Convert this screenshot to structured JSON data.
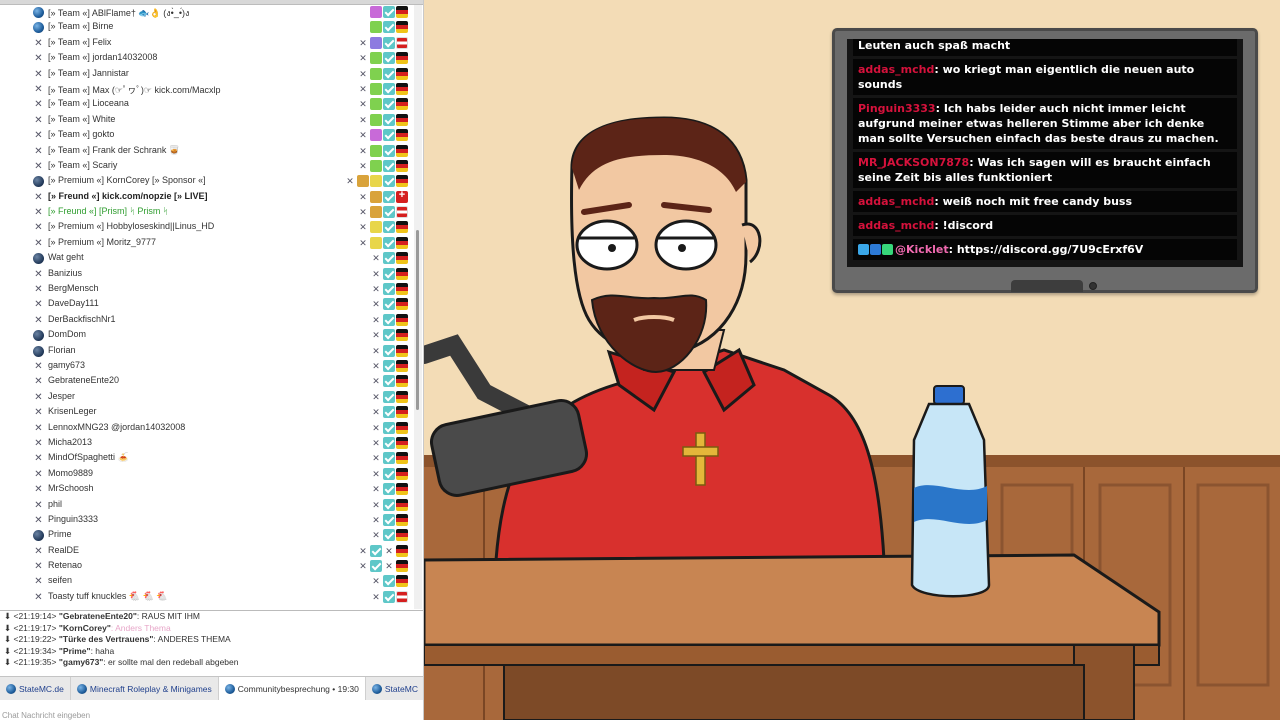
{
  "users": [
    {
      "name": "[» Team «] ABlFlame† 🐟👌 (ง•̀_•́)ง",
      "icon": "ball",
      "style": "",
      "badges": [
        "purple",
        "check",
        "de"
      ]
    },
    {
      "name": "[» Team «] Birne",
      "icon": "ball",
      "style": "",
      "badges": [
        "lime",
        "check",
        "de"
      ]
    },
    {
      "name": "[» Team «] Felix",
      "icon": "mute",
      "style": "",
      "badges": [
        "mute",
        "violet",
        "check",
        "at"
      ]
    },
    {
      "name": "[» Team «] jordan14032008",
      "icon": "mute",
      "style": "",
      "badges": [
        "mute",
        "lime",
        "check",
        "de"
      ]
    },
    {
      "name": "[» Team «] Jannistar",
      "icon": "mute",
      "style": "",
      "badges": [
        "mute",
        "lime",
        "check",
        "de"
      ]
    },
    {
      "name": "[» Team «] Max (☞ﾟヮﾟ)☞ kick.com/Macxlp",
      "icon": "mute",
      "style": "",
      "badges": [
        "mute",
        "lime",
        "check",
        "de"
      ]
    },
    {
      "name": "[» Team «] Lioceana",
      "icon": "mute",
      "style": "",
      "badges": [
        "mute",
        "lime",
        "check",
        "de"
      ]
    },
    {
      "name": "[» Team «] White",
      "icon": "mute",
      "style": "",
      "badges": [
        "mute",
        "lime",
        "check",
        "de"
      ]
    },
    {
      "name": "[» Team «] gokto",
      "icon": "mute",
      "style": "",
      "badges": [
        "mute",
        "purple",
        "check",
        "de"
      ]
    },
    {
      "name": "[» Team «] Frank der Schrank 🥃",
      "icon": "mute",
      "style": "",
      "badges": [
        "mute",
        "lime",
        "check",
        "de"
      ]
    },
    {
      "name": "[» Team «] Scariy",
      "icon": "mute",
      "style": "",
      "badges": [
        "mute",
        "lime",
        "check",
        "de"
      ]
    },
    {
      "name": "[» Premium «] KornCorey [» Sponsor «]",
      "icon": "dark",
      "style": "",
      "badges": [
        "mute",
        "gold",
        "yellow",
        "check",
        "de"
      ]
    },
    {
      "name": "[» Freund «] kick.com/nopzie [» LIVE]",
      "icon": "mute",
      "style": "bold",
      "badges": [
        "mute",
        "gold",
        "check",
        "ch"
      ]
    },
    {
      "name": "[» Freund «] [Prism] ᛋ Prism ᛋ",
      "icon": "mute",
      "style": "green",
      "badges": [
        "mute",
        "gold",
        "check",
        "at"
      ]
    },
    {
      "name": "[» Premium «] Hobbyloseskind||Linus_HD",
      "icon": "mute",
      "style": "",
      "badges": [
        "mute",
        "yellow",
        "check",
        "de"
      ]
    },
    {
      "name": "[» Premium «] Moritz_9777",
      "icon": "mute",
      "style": "",
      "badges": [
        "mute",
        "yellow",
        "check",
        "de"
      ]
    },
    {
      "name": "Wat geht",
      "icon": "dark",
      "style": "",
      "badges": [
        "mute",
        "check",
        "de"
      ]
    },
    {
      "name": "Banizius",
      "icon": "mute",
      "style": "",
      "badges": [
        "mute",
        "check",
        "de"
      ]
    },
    {
      "name": "BergMensch",
      "icon": "mute",
      "style": "",
      "badges": [
        "mute",
        "check",
        "de"
      ]
    },
    {
      "name": "DaveDay111",
      "icon": "mute",
      "style": "",
      "badges": [
        "mute",
        "check",
        "de"
      ]
    },
    {
      "name": "DerBackfischNr1",
      "icon": "mute",
      "style": "",
      "badges": [
        "mute",
        "check",
        "de"
      ]
    },
    {
      "name": "DomDom",
      "icon": "dark",
      "style": "",
      "badges": [
        "mute",
        "check",
        "de"
      ]
    },
    {
      "name": "Florian",
      "icon": "dark",
      "style": "",
      "badges": [
        "mute",
        "check",
        "de"
      ]
    },
    {
      "name": "gamy673",
      "icon": "mute",
      "style": "",
      "badges": [
        "mute",
        "check",
        "de"
      ]
    },
    {
      "name": "GebrateneEnte20",
      "icon": "mute",
      "style": "",
      "badges": [
        "mute",
        "check",
        "de"
      ]
    },
    {
      "name": "Jesper",
      "icon": "mute",
      "style": "",
      "badges": [
        "mute",
        "check",
        "de"
      ]
    },
    {
      "name": "KrisenLeger",
      "icon": "mute",
      "style": "",
      "badges": [
        "mute",
        "check",
        "de"
      ]
    },
    {
      "name": "LennoxMNG23 @jordan14032008",
      "icon": "mute",
      "style": "",
      "badges": [
        "mute",
        "check",
        "de"
      ]
    },
    {
      "name": "Micha2013",
      "icon": "mute",
      "style": "",
      "badges": [
        "mute",
        "check",
        "de"
      ]
    },
    {
      "name": "MindOfSpaghetti 🍝",
      "icon": "mute",
      "style": "",
      "badges": [
        "mute",
        "check",
        "de"
      ]
    },
    {
      "name": "Momo9889",
      "icon": "mute",
      "style": "",
      "badges": [
        "mute",
        "check",
        "de"
      ]
    },
    {
      "name": "MrSchoosh",
      "icon": "mute",
      "style": "",
      "badges": [
        "mute",
        "check",
        "de"
      ]
    },
    {
      "name": "phil",
      "icon": "mute",
      "style": "",
      "badges": [
        "mute",
        "check",
        "de"
      ]
    },
    {
      "name": "Pinguin3333",
      "icon": "mute",
      "style": "",
      "badges": [
        "mute",
        "check",
        "de"
      ]
    },
    {
      "name": "Prime",
      "icon": "dark",
      "style": "",
      "badges": [
        "mute",
        "check",
        "de"
      ]
    },
    {
      "name": "RealDE",
      "icon": "mute",
      "style": "",
      "badges": [
        "mute",
        "check",
        "mute",
        "de"
      ]
    },
    {
      "name": "Retenao",
      "icon": "mute",
      "style": "",
      "badges": [
        "mute",
        "check",
        "mute",
        "de"
      ]
    },
    {
      "name": "seifen",
      "icon": "mute",
      "style": "",
      "badges": [
        "mute",
        "check",
        "de"
      ]
    },
    {
      "name": "Toasty tuff knuckles 🐔 🐔 🐔",
      "icon": "mute",
      "style": "",
      "badges": [
        "mute",
        "check",
        "at"
      ]
    }
  ],
  "chat_log": [
    {
      "time": "<21:19:14>",
      "user": "\"GebrateneEnte20\"",
      "text": ": RAUS MIT IHM",
      "faint": false
    },
    {
      "time": "<21:19:17>",
      "user": "\"KornCorey\"",
      "text": ": Anders Thema",
      "faint": true
    },
    {
      "time": "<21:19:22>",
      "user": "\"Türke des Vertrauens\"",
      "text": ": ANDERES THEMA",
      "faint": false
    },
    {
      "time": "<21:19:34>",
      "user": "\"Prime\"",
      "text": ": haha",
      "faint": false
    },
    {
      "time": "<21:19:35>",
      "user": "\"gamy673\"",
      "text": ": er sollte mal den redeball abgeben",
      "faint": false
    }
  ],
  "tabs": [
    {
      "label": "StateMC.de",
      "active": false
    },
    {
      "label": "Minecraft Roleplay & Minigames",
      "active": false
    },
    {
      "label": "Communitybesprechung • 19:30",
      "active": true
    },
    {
      "label": "StateMC",
      "active": false
    }
  ],
  "chat_input_placeholder": "Chat Nachricht eingeben",
  "tv_chat": [
    {
      "user": "",
      "text": "Leuten auch spaß macht",
      "user_color": "red",
      "first": true
    },
    {
      "user": "addas_mchd",
      "text": ": wo kriegt man eigentlich die neuen auto sounds",
      "user_color": "red"
    },
    {
      "user": "Pinguin3333",
      "text": ": Ich habs leider auch nicht immer leicht aufgrund meiner etwas helleren Stimme aber ich denke man sollte Versuchen einfach das beste draus zu machen.",
      "user_color": "red"
    },
    {
      "user": "MR_JACKSON7878",
      "text": ": Was ich sagen will es braucht einfach seine Zeit bis alles funktioniert",
      "user_color": "red"
    },
    {
      "user": "addas_mchd",
      "text": ": weiß noch mit free candy buss",
      "user_color": "red"
    },
    {
      "user": "addas_mchd",
      "text": ": !discord",
      "user_color": "red"
    },
    {
      "user": "@Kicklet",
      "text": ": https://discord.gg/7U9cErxf6V",
      "user_color": "pink",
      "emotes": true
    }
  ],
  "colors": {
    "badge_check": "#5ec7c8",
    "chat_user_red": "#d6123c",
    "kicklet_pink": "#f06ab0",
    "wall": "#f3dcb6",
    "wood": "#a8683b",
    "shirt": "#d8302d"
  }
}
